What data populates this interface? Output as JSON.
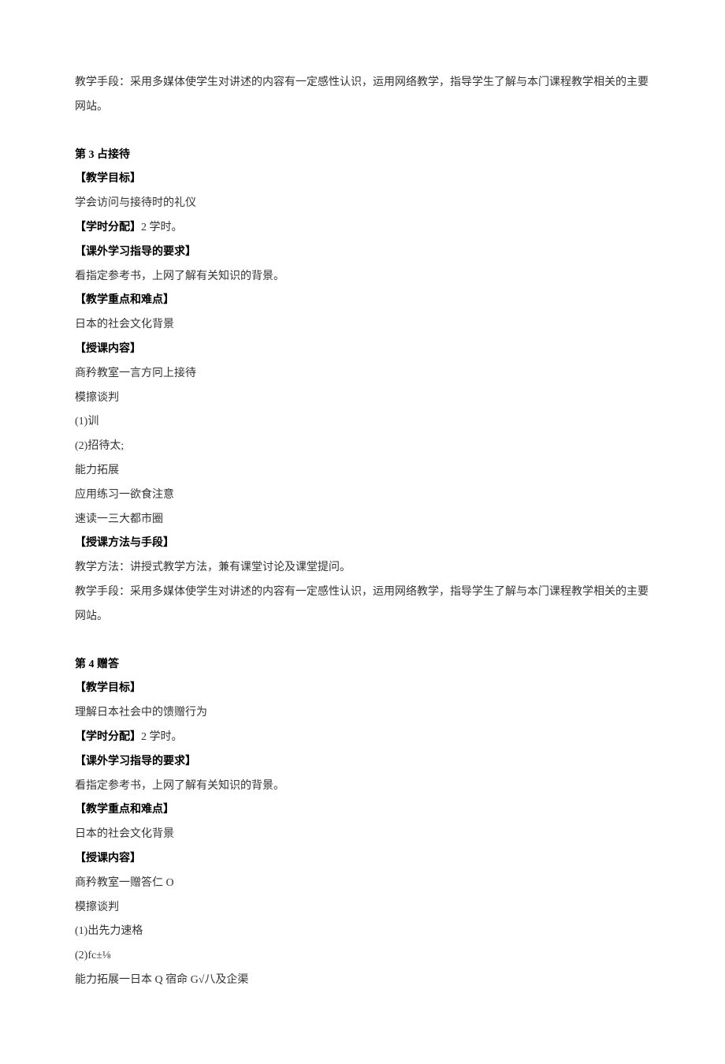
{
  "intro_paragraph": "教学手段：采用多媒体使学生对讲述的内容有一定感性认识，运用网络教学，指导学生了解与本门课程教学相关的主要网站。",
  "section3": {
    "title": "第 3 占接待",
    "goal_label": "【教学目标】",
    "goal_text": "学会访问与接待时的礼仪",
    "hours_label": "【学时分配】",
    "hours_text": "2 学时。",
    "extra_label": "【课外学习指导的要求】",
    "extra_text": "看指定参考书，上网了解有关知识的背景。",
    "focus_label": "【教学重点和难点】",
    "focus_text": "日本的社会文化背景",
    "content_label": "【授课内容】",
    "content_lines": [
      "商矜教室一言方冋上接待",
      "模擦谈判",
      "(1)训",
      "(2)招待太;",
      "能力拓展",
      "应用练习一欲食注意",
      "速读一三大都市圈"
    ],
    "method_label": "【授课方法与手段】",
    "method_text1": "教学方法：讲授式教学方法，兼有课堂讨论及课堂提问。",
    "method_text2": "教学手段：采用多媒体使学生对讲述的内容有一定感性认识，运用网络教学，指导学生了解与本门课程教学相关的主要网站。"
  },
  "section4": {
    "title": "第 4 赠答",
    "goal_label": "【教学目标】",
    "goal_text": "理解日本社会中的馈赠行为",
    "hours_label": "【学时分配】",
    "hours_text": "2 学时。",
    "extra_label": "【课外学习指导的要求】",
    "extra_text": "看指定参考书，上网了解有关知识的背景。",
    "focus_label": "【教学重点和难点】",
    "focus_text": "日本的社会文化背景",
    "content_label": "【授课内容】",
    "content_lines": [
      "商矜教室一赠答仁 O",
      "模擦谈判",
      "(1)出先力速格",
      "(2)fc±⅛",
      "能力拓展一日本 Q 宿命 G√八及企渠"
    ]
  }
}
